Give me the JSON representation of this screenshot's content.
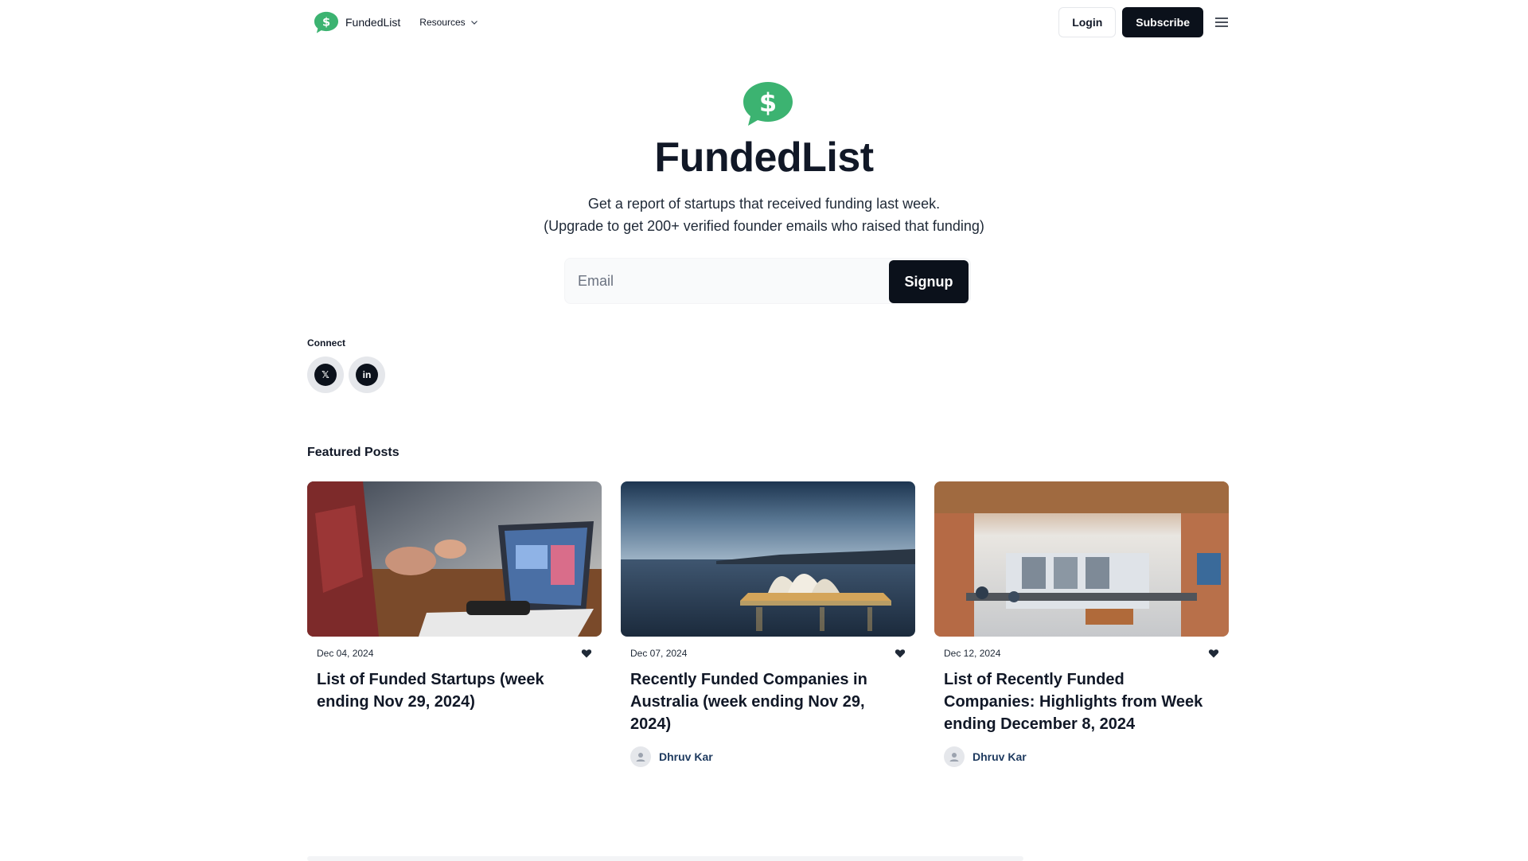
{
  "colors": {
    "brand_green": "#3cb371",
    "dark": "#0b111b",
    "author_blue": "#1e3a5f"
  },
  "nav": {
    "brand_name": "FundedList",
    "brand_icon": "dollar-speech-bubble-icon",
    "resources_label": "Resources",
    "login_label": "Login",
    "subscribe_label": "Subscribe",
    "menu_icon": "hamburger-menu-icon"
  },
  "hero": {
    "title": "FundedList",
    "subtitle_line1": "Get a report of startups that received funding last week.",
    "subtitle_line2": "(Upgrade to get 200+ verified founder emails who raised that funding)",
    "email_placeholder": "Email",
    "email_value": "",
    "signup_label": "Signup"
  },
  "connect": {
    "label": "Connect",
    "links": [
      {
        "icon": "x-twitter-icon",
        "glyph": "𝕏"
      },
      {
        "icon": "linkedin-icon",
        "glyph": "in"
      }
    ]
  },
  "featured": {
    "label": "Featured Posts",
    "posts": [
      {
        "date": "Dec 04, 2024",
        "title": "List of Funded Startups (week ending Nov 29, 2024)",
        "image": "laptop-meeting-photo",
        "author": ""
      },
      {
        "date": "Dec 07, 2024",
        "title": "Recently Funded Companies in Australia (week ending Nov 29, 2024)",
        "image": "sydney-opera-house-photo",
        "author": "Dhruv Kar"
      },
      {
        "date": "Dec 12, 2024",
        "title": "List of Recently Funded Companies: Highlights from Week ending December 8, 2024",
        "image": "open-office-photo",
        "author": "Dhruv Kar"
      }
    ]
  }
}
